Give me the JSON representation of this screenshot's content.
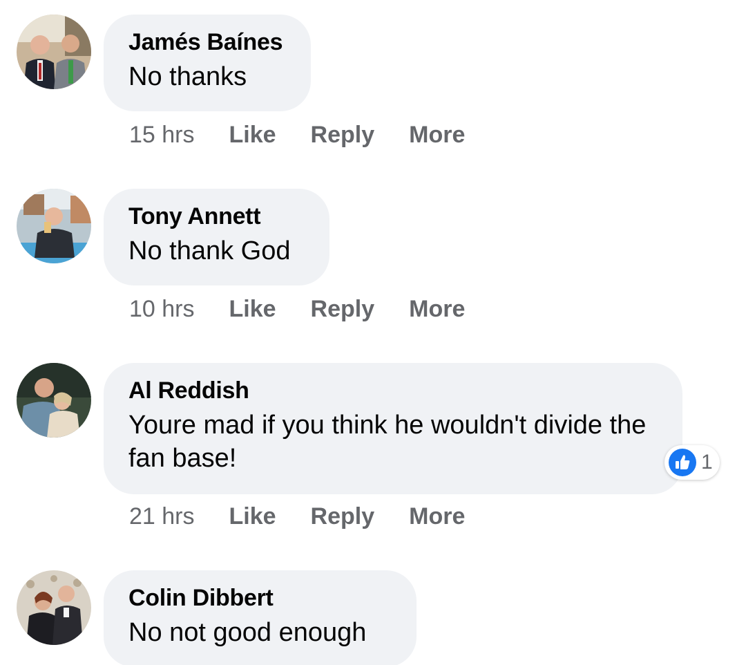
{
  "comments": [
    {
      "author": "Jamés Baínes",
      "text": "No thanks",
      "time": "15 hrs",
      "actions": {
        "like": "Like",
        "reply": "Reply",
        "more": "More"
      }
    },
    {
      "author": "Tony Annett",
      "text": "No thank God",
      "time": "10 hrs",
      "actions": {
        "like": "Like",
        "reply": "Reply",
        "more": "More"
      }
    },
    {
      "author": "Al Reddish",
      "text": "Youre mad if you think he wouldn't divide the fan base!",
      "time": "21 hrs",
      "actions": {
        "like": "Like",
        "reply": "Reply",
        "more": "More"
      },
      "reaction": {
        "icon": "thumbs-up-icon",
        "count": "1"
      }
    },
    {
      "author": "Colin Dibbert",
      "text": "No not good enough"
    }
  ],
  "colors": {
    "bubble": "#f0f2f5",
    "meta_text": "#65676b",
    "like_blue": "#1877f2"
  }
}
